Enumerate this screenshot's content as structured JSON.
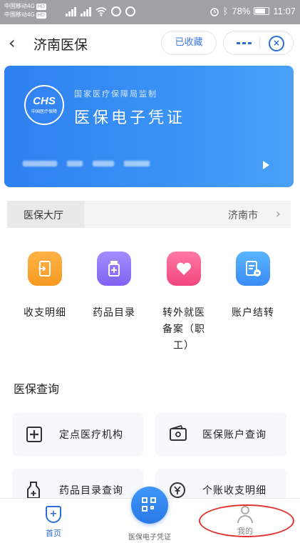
{
  "status_bar": {
    "carrier_1": "中国移动4G",
    "carrier_2": "中国移动4G",
    "hd": "HD",
    "battery": "78%",
    "time": "11:07"
  },
  "header": {
    "title": "济南医保",
    "favorite_label": "已收藏"
  },
  "card": {
    "logo_text": "CHS",
    "logo_sub": "中国医疗保障",
    "supervisor": "国家医疗保障局监制",
    "title": "医保电子凭证"
  },
  "hall": {
    "label": "医保大厅",
    "city": "济南市"
  },
  "services": [
    {
      "label": "收支明细",
      "icon": "ledger-icon"
    },
    {
      "label": "药品目录",
      "icon": "medicine-bottle-icon"
    },
    {
      "label": "转外就医备案（职工）",
      "label_lines": [
        "转外就医",
        "备案（职",
        "工）"
      ],
      "icon": "heart-icon"
    },
    {
      "label": "账户结转",
      "icon": "account-transfer-icon"
    }
  ],
  "section": {
    "title": "医保查询",
    "items": [
      {
        "label": "定点医疗机构",
        "icon": "hospital-cross-icon"
      },
      {
        "label": "医保账户查询",
        "icon": "wallet-icon"
      },
      {
        "label": "药品目录查询",
        "icon": "medicine-bottle-icon"
      },
      {
        "label": "个账收支明细",
        "icon": "yuan-coin-icon"
      }
    ]
  },
  "tabbar": {
    "home": "首页",
    "center": "医保电子凭证",
    "mine": "我的"
  },
  "colors": {
    "accent": "#2b6fd6",
    "card_start": "#2f80f0",
    "card_end": "#4aa1f8",
    "annotation": "#e0322f"
  }
}
